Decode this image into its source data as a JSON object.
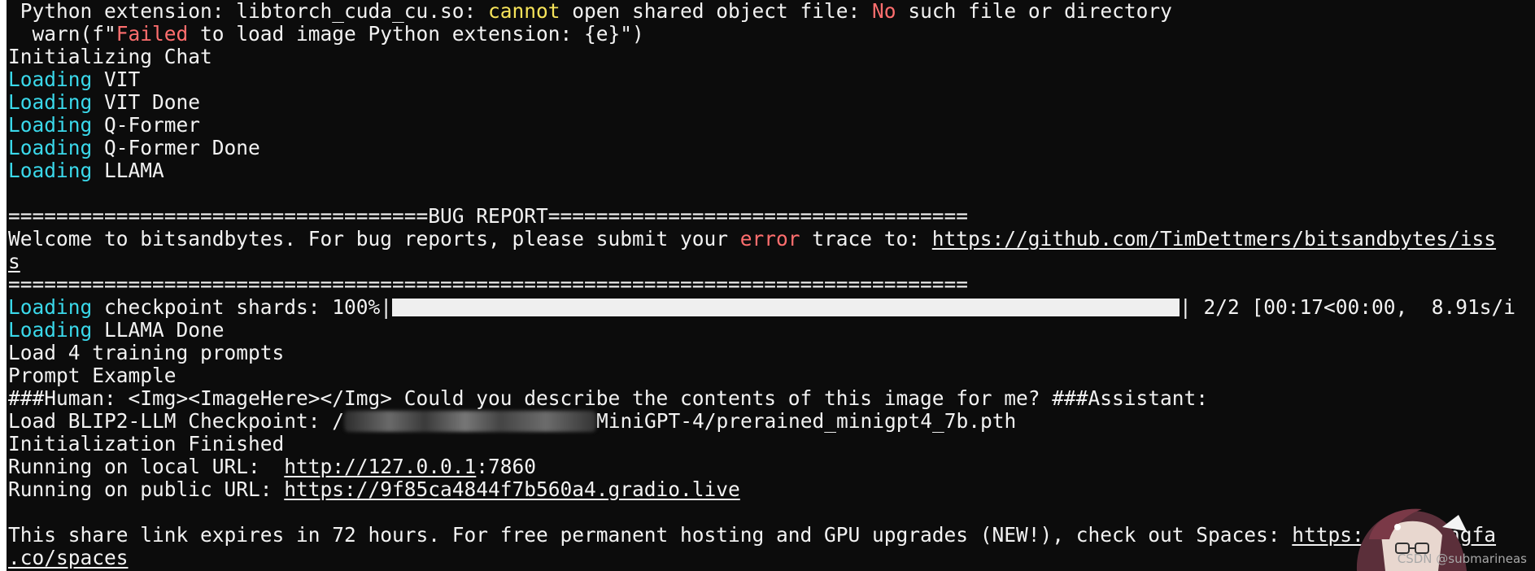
{
  "terminal": {
    "lines": [
      [
        {
          "t": " Python extension: libtorch_cuda_cu.so: "
        },
        {
          "t": "cannot",
          "c": "yellow"
        },
        {
          "t": " open shared object file: "
        },
        {
          "t": "No",
          "c": "red"
        },
        {
          "t": " such file or directory"
        }
      ],
      [
        {
          "t": "  warn(f\""
        },
        {
          "t": "Failed",
          "c": "red"
        },
        {
          "t": " to load image Python extension: {e}\")"
        }
      ],
      [
        {
          "t": "Initializing Chat"
        }
      ],
      [
        {
          "t": "Loading",
          "c": "cyan"
        },
        {
          "t": " VIT"
        }
      ],
      [
        {
          "t": "Loading",
          "c": "cyan"
        },
        {
          "t": " VIT Done"
        }
      ],
      [
        {
          "t": "Loading",
          "c": "cyan"
        },
        {
          "t": " Q-Former"
        }
      ],
      [
        {
          "t": "Loading",
          "c": "cyan"
        },
        {
          "t": " Q-Former Done"
        }
      ],
      [
        {
          "t": "Loading",
          "c": "cyan"
        },
        {
          "t": " LLAMA"
        }
      ],
      [],
      [
        {
          "t": "===================================BUG REPORT==================================="
        }
      ],
      [
        {
          "t": "Welcome to bitsandbytes. For bug reports, please submit your "
        },
        {
          "t": "error",
          "c": "red"
        },
        {
          "t": " trace to: "
        },
        {
          "t": "https://github.com/TimDettmers/bitsandbytes/iss",
          "u": true
        }
      ],
      [
        {
          "t": "s",
          "u": true
        }
      ],
      [
        {
          "t": "================================================================================"
        }
      ],
      [
        {
          "t": "Loading",
          "c": "cyan"
        },
        {
          "t": " checkpoint shards: 100%|"
        },
        {
          "bar": true
        },
        {
          "t": "| 2/2 [00:17<00:00,  8.91s/i"
        }
      ],
      [
        {
          "t": "Loading",
          "c": "cyan"
        },
        {
          "t": " LLAMA Done"
        }
      ],
      [
        {
          "t": "Load 4 training prompts"
        }
      ],
      [
        {
          "t": "Prompt Example"
        }
      ],
      [
        {
          "t": "###Human: <Img><ImageHere></Img> Could you describe the contents of this image for me? ###Assistant:"
        }
      ],
      [
        {
          "t": "Load BLIP2-LLM Checkpoint: /"
        },
        {
          "blur": true
        },
        {
          "t": "MiniGPT-4/prerained_minigpt4_7b.pth"
        }
      ],
      [
        {
          "t": "Initialization Finished"
        }
      ],
      [
        {
          "t": "Running on local URL:  "
        },
        {
          "t": "http://127.0.0.1",
          "u": true
        },
        {
          "t": ":7860"
        }
      ],
      [
        {
          "t": "Running on public URL: "
        },
        {
          "t": "https://9f85ca4844f7b560a4.gradio.live",
          "u": true
        }
      ],
      [],
      [
        {
          "t": "This share link expires in 72 hours. For free permanent hosting and GPU upgrades (NEW!), check out Spaces: "
        },
        {
          "t": "https://huggingfa",
          "u": true
        }
      ],
      [
        {
          "t": ".co/spaces",
          "u": true
        }
      ]
    ],
    "progress": {
      "label": "checkpoint shards",
      "percent": 100,
      "done": 2,
      "total": 2
    }
  },
  "watermark": "CSDN @submarineas",
  "colors": {
    "background": "#0c0c0c",
    "text": "#f2f2f2",
    "cyan": "#3ad8ea",
    "red": "#ff6e6e",
    "yellow": "#f6e35a"
  },
  "icons": {
    "avatar": "anime-avatar-icon"
  }
}
